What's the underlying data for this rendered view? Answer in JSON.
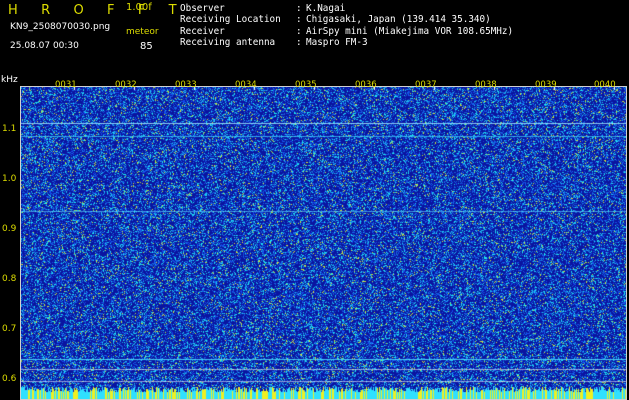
{
  "header": {
    "title": "H R O F F T",
    "version": "1.00f",
    "file_name": "KN9_2508070030.png",
    "meteor_label": "meteor",
    "timestamp": "25.08.07 00:30",
    "meteor_count": "85"
  },
  "info": [
    {
      "key": "Observer",
      "value": "K.Nagai"
    },
    {
      "key": "Receiving Location",
      "value": "Chigasaki, Japan (139.414 35.340)"
    },
    {
      "key": "Receiver",
      "value": "AirSpy mini (Miakejima VOR 108.65MHz)"
    },
    {
      "key": "Receiving antenna",
      "value": "Maspro FM-3"
    }
  ],
  "info_separator": ":",
  "axis": {
    "y_unit": "kHz",
    "y_ticks": [
      "1.1",
      "1.0",
      "0.9",
      "0.8",
      "0.7",
      "0.6"
    ],
    "x_ticks": [
      "0031",
      "0032",
      "0033",
      "0034",
      "0035",
      "0036",
      "0037",
      "0038",
      "0039",
      "0040"
    ]
  },
  "colors": {
    "background": "#0a14a0",
    "noise_cyan": "#30e0ff",
    "noise_yellow": "#f0f020",
    "label_yellow": "#dcdc00",
    "text": "#ffffff"
  }
}
